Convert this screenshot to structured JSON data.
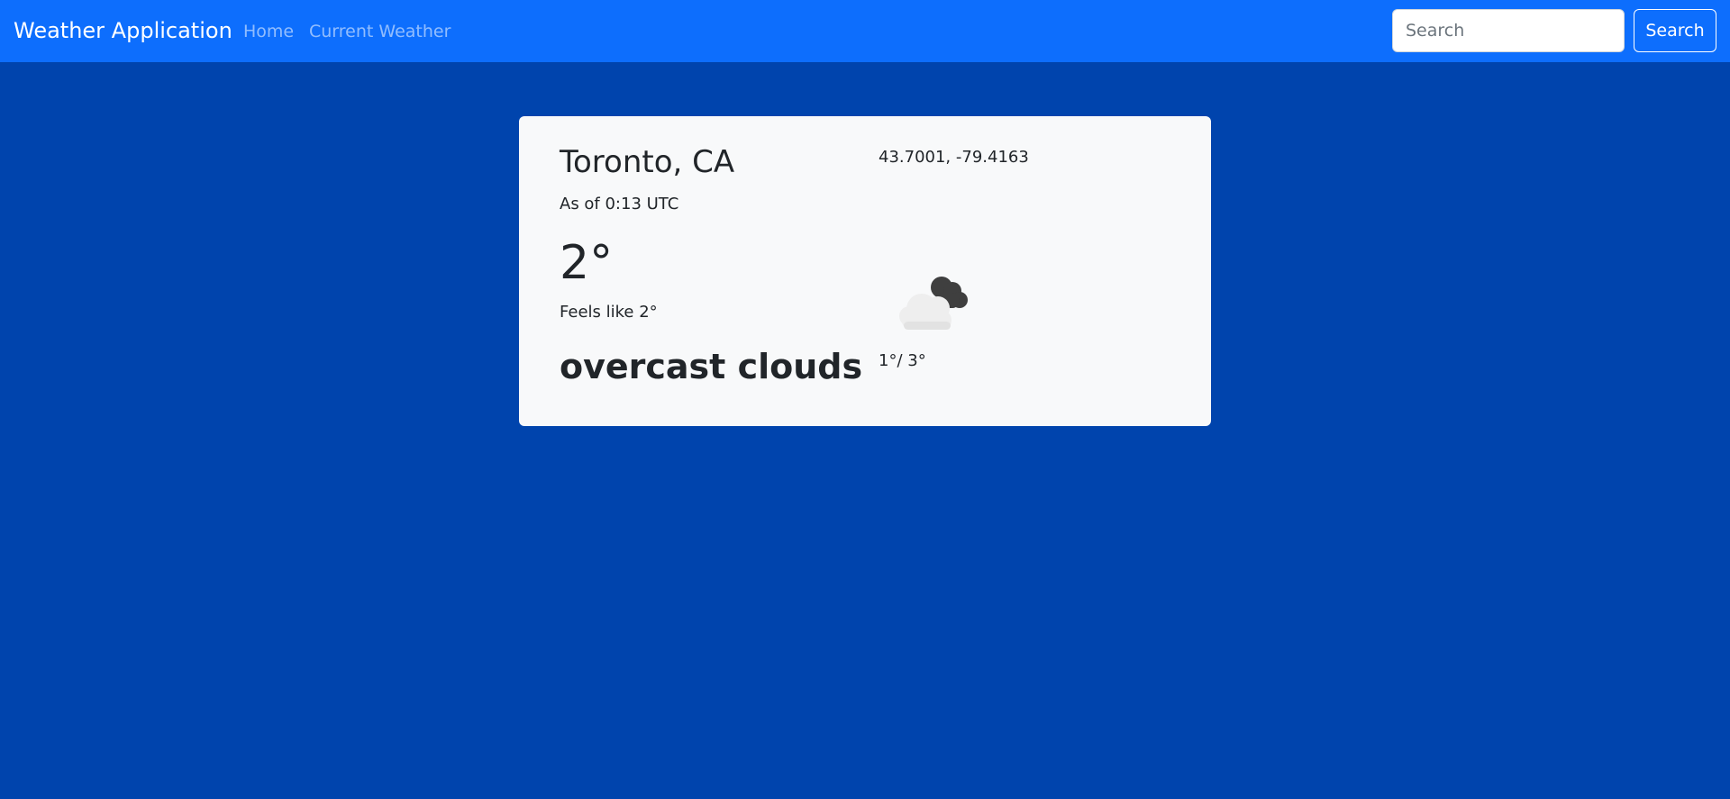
{
  "navbar": {
    "brand": "Weather Application",
    "links": [
      {
        "label": "Home"
      },
      {
        "label": "Current Weather"
      }
    ],
    "search": {
      "placeholder": "Search",
      "value": "",
      "button_label": "Search"
    },
    "background_color": "#0d6efd"
  },
  "page": {
    "background_color": "#0044ad"
  },
  "weather_card": {
    "location": "Toronto, CA",
    "as_of": "As of 0:13 UTC",
    "temperature": "2°",
    "feels_like": "Feels like 2°",
    "description": "overcast clouds",
    "coordinates": "43.7001, -79.4163",
    "min_max": "1°/ 3°",
    "icon": "overcast-clouds-icon",
    "background_color": "#f8f9fa"
  }
}
